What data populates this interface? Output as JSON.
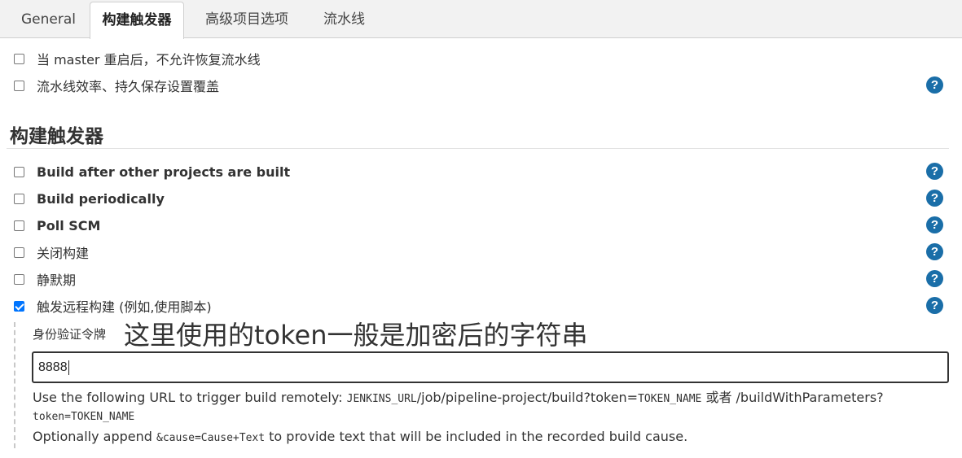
{
  "tabs": [
    {
      "label": "General",
      "active": false
    },
    {
      "label": "构建触发器",
      "active": true
    },
    {
      "label": "高级项目选项",
      "active": false
    },
    {
      "label": "流水线",
      "active": false
    }
  ],
  "general_options": [
    {
      "label": "当 master 重启后，不允许恢复流水线",
      "checked": false,
      "help": false
    },
    {
      "label": "流水线效率、持久保存设置覆盖",
      "checked": false,
      "help": true
    }
  ],
  "section": {
    "title": "构建触发器"
  },
  "triggers": [
    {
      "label": "Build after other projects are built",
      "checked": false
    },
    {
      "label": "Build periodically",
      "checked": false
    },
    {
      "label": "Poll SCM",
      "checked": false
    },
    {
      "label": "关闭构建",
      "checked": false
    },
    {
      "label": "静默期",
      "checked": false
    },
    {
      "label": "触发远程构建 (例如,使用脚本)",
      "checked": true
    }
  ],
  "remote": {
    "token_label": "身份验证令牌",
    "annotation": "这里使用的token一般是加密后的字符串",
    "token_value": "8888",
    "line1_prefix": "Use the following URL to trigger build remotely: ",
    "line1_code1": "JENKINS_URL",
    "line1_mid": "/job/pipeline-project/build?token=",
    "line1_code2": "TOKEN_NAME",
    "line1_suffix": " 或者 /buildWithParameters?",
    "line2_code": "token=TOKEN_NAME",
    "line3_prefix": "Optionally append ",
    "line3_code": "&cause=Cause+Text",
    "line3_suffix": " to provide text that will be included in the recorded build cause."
  },
  "icons": {
    "help": "help-icon"
  },
  "colors": {
    "help_bg": "#1a6ea8",
    "checkbox_checked": "#0075ff",
    "tabbar_bg": "#f2f2f2"
  }
}
